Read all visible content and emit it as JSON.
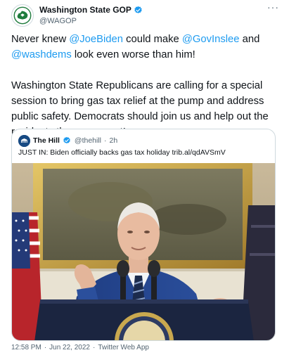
{
  "author": {
    "display_name": "Washington State GOP",
    "handle": "@WAGOP",
    "avatar_icon": "state-seal-logo-icon",
    "verified_icon": "verified-badge-icon",
    "more_icon": "more-options-icon"
  },
  "text": {
    "p1": [
      {
        "t": "Never knew ",
        "type": "text"
      },
      {
        "t": "@JoeBiden",
        "type": "mention"
      },
      {
        "t": " could make ",
        "type": "text"
      },
      {
        "t": "@GovInslee",
        "type": "mention"
      },
      {
        "t": " and ",
        "type": "text"
      },
      {
        "t": "@washdems",
        "type": "mention"
      },
      {
        "t": " look even worse than him!",
        "type": "text"
      }
    ],
    "p2": "Washington State Republicans are calling for a special session to bring gas tax relief at the pump and address public safety. Democrats should join us and help out the residents they represent!"
  },
  "quote": {
    "display_name": "The Hill",
    "handle": "@thehill",
    "separator": "·",
    "time": "2h",
    "text": "JUST IN: Biden officially backs gas tax holiday trib.al/qdAVSmV",
    "media_icon": "press-briefing-photo"
  },
  "footer": {
    "time": "12:58 PM",
    "separator1": "·",
    "date": "Jun 22, 2022",
    "separator2": "·",
    "source": "Twitter Web App"
  },
  "colors": {
    "link": "#1d9bf0",
    "verified": "#1d9bf0",
    "secondary_text": "#536471",
    "border": "#cfd9de"
  }
}
